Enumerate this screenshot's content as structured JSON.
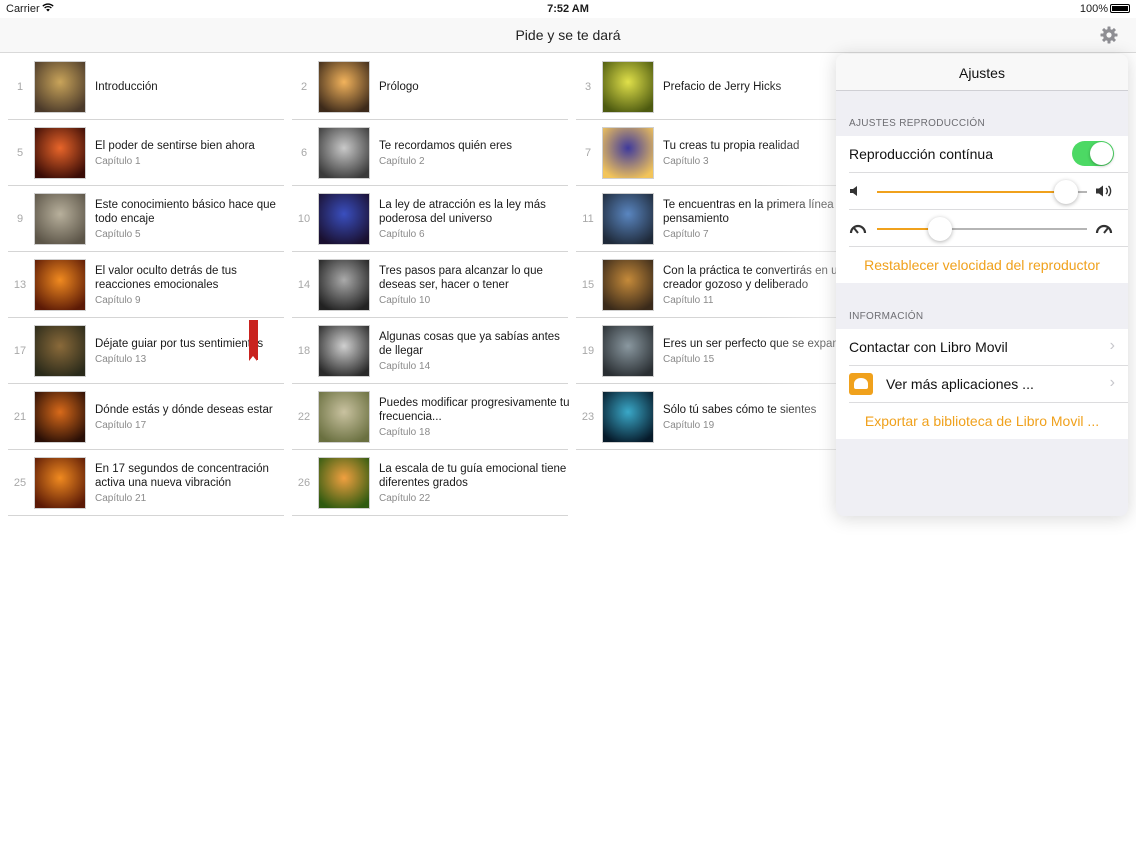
{
  "status_bar": {
    "carrier": "Carrier",
    "time": "7:52 AM",
    "battery": "100%"
  },
  "nav": {
    "title": "Pide y se te dará"
  },
  "chapters": [
    {
      "num": "1",
      "title": "Introducción",
      "sub": ""
    },
    {
      "num": "2",
      "title": "Prólogo",
      "sub": ""
    },
    {
      "num": "3",
      "title": "Prefacio de Jerry Hicks",
      "sub": ""
    },
    {
      "num": "5",
      "title": "El poder de sentirse bien ahora",
      "sub": "Capítulo 1"
    },
    {
      "num": "6",
      "title": "Te recordamos quién eres",
      "sub": "Capítulo 2"
    },
    {
      "num": "7",
      "title": "Tu creas tu propia realidad",
      "sub": "Capítulo 3"
    },
    {
      "num": "9",
      "title": "Este conocimiento básico hace que todo encaje",
      "sub": "Capítulo 5"
    },
    {
      "num": "10",
      "title": "La ley de atracción es la ley más poderosa del universo",
      "sub": "Capítulo 6"
    },
    {
      "num": "11",
      "title": "Te encuentras en la primera línea del pensamiento",
      "sub": "Capítulo 7"
    },
    {
      "num": "13",
      "title": "El valor oculto detrás de tus reacciones emocionales",
      "sub": "Capítulo 9"
    },
    {
      "num": "14",
      "title": "Tres pasos para alcanzar lo que deseas ser, hacer o tener",
      "sub": "Capítulo 10"
    },
    {
      "num": "15",
      "title": "Con la práctica te convertirás en un creador gozoso y deliberado",
      "sub": "Capítulo 11"
    },
    {
      "num": "17",
      "title": "Déjate guiar por tus sentimientos",
      "sub": "Capítulo 13"
    },
    {
      "num": "18",
      "title": "Algunas cosas que ya sabías antes de llegar",
      "sub": "Capítulo 14"
    },
    {
      "num": "19",
      "title": "Eres un ser perfecto que se expande",
      "sub": "Capítulo 15"
    },
    {
      "num": "21",
      "title": "Dónde estás y dónde deseas estar",
      "sub": "Capítulo 17"
    },
    {
      "num": "22",
      "title": "Puedes modificar progresivamente tu frecuencia...",
      "sub": "Capítulo 18"
    },
    {
      "num": "23",
      "title": "Sólo tú sabes cómo te sientes",
      "sub": "Capítulo 19"
    },
    {
      "num": "25",
      "title": "En 17 segundos de concentración activa una nueva vibración",
      "sub": "Capítulo 21"
    },
    {
      "num": "26",
      "title": "La escala de tu guía emocional tiene  diferentes grados",
      "sub": "Capítulo 22"
    }
  ],
  "thumb_colors": [
    [
      "#c9a45a",
      "#4b3a2a"
    ],
    [
      "#f2b35c",
      "#3d2a1a"
    ],
    [
      "#e0e04a",
      "#4d5a10"
    ],
    [
      "#e8652a",
      "#3a0c06"
    ],
    [
      "#c9c9c9",
      "#3a3a3a"
    ],
    [
      "#3f3a9c",
      "#f2c45a"
    ],
    [
      "#b8b09c",
      "#5c5548"
    ],
    [
      "#3a4fbf",
      "#1a1030"
    ],
    [
      "#5a86c0",
      "#1f2a3a"
    ],
    [
      "#f08a20",
      "#5c1a06"
    ],
    [
      "#aaaaaa",
      "#222222"
    ],
    [
      "#c58a3a",
      "#3a2a1a"
    ],
    [
      "#8a6a3a",
      "#2a2a1a"
    ],
    [
      "#d0d0d0",
      "#2a2a2a"
    ],
    [
      "#8a98a0",
      "#2a2f33"
    ],
    [
      "#d86a1a",
      "#2a0f06"
    ],
    [
      "#c9c2a0",
      "#6a7040"
    ],
    [
      "#3aa8c8",
      "#061a2a"
    ],
    [
      "#f08a20",
      "#5c1a06"
    ],
    [
      "#f0a040",
      "#2f5a10"
    ]
  ],
  "settings": {
    "title": "Ajustes",
    "section_playback": "AJUSTES REPRODUCCIÓN",
    "continuous_label": "Reproducción contínua",
    "continuous_on": true,
    "volume_level": 0.9,
    "speed_level": 0.3,
    "reset_speed_label": "Restablecer velocidad del reproductor",
    "section_info": "INFORMACIÓN",
    "contact_label": "Contactar con Libro Movil",
    "more_apps_label": "Ver más aplicaciones ...",
    "export_label": "Exportar a biblioteca de Libro Movil ...",
    "accent_color": "#f0a11c",
    "toggle_color": "#4cd964"
  }
}
